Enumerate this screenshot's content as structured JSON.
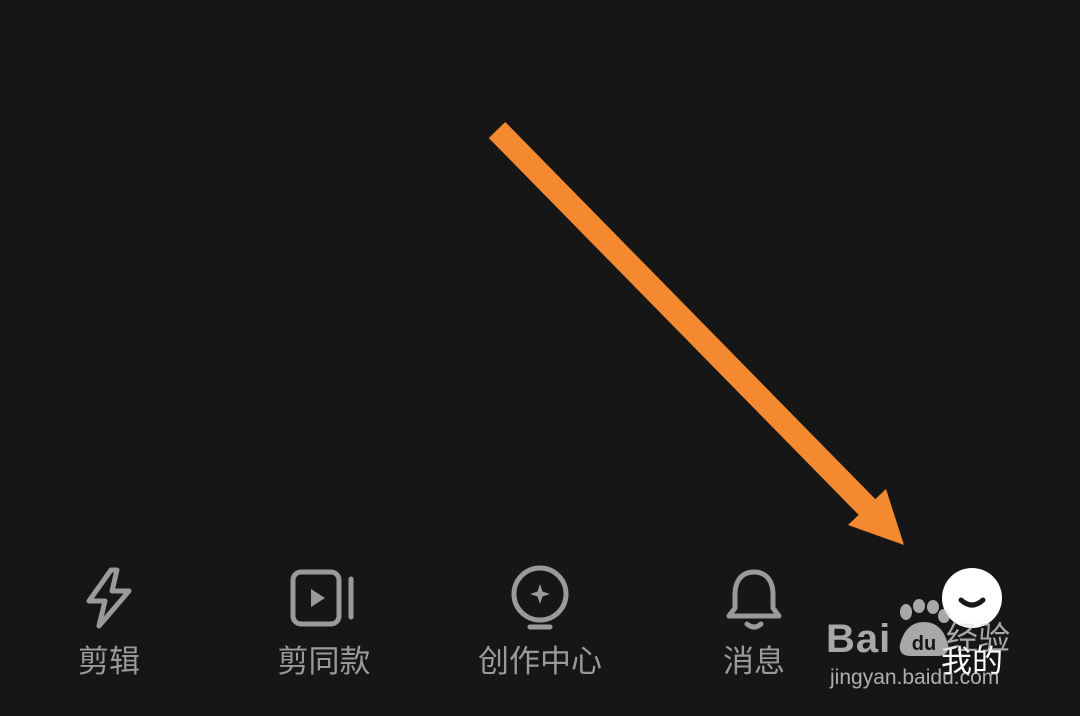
{
  "tabbar": {
    "tabs": [
      {
        "label": "剪辑",
        "icon": "lightning-icon"
      },
      {
        "label": "剪同款",
        "icon": "play-video-icon"
      },
      {
        "label": "创作中心",
        "icon": "lightbulb-sparkle-icon"
      },
      {
        "label": "消息",
        "icon": "bell-icon"
      },
      {
        "label": "我的",
        "icon": "smile-face-icon"
      }
    ],
    "active_index": 4
  },
  "watermark": {
    "brand": "Bai",
    "brand_paw": "du",
    "cn": "经验",
    "url": "jingyan.baidu.com"
  },
  "colors": {
    "background": "#161616",
    "arrow": "#F5892F",
    "inactive": "#9A9A9A",
    "active": "#FFFFFF"
  }
}
